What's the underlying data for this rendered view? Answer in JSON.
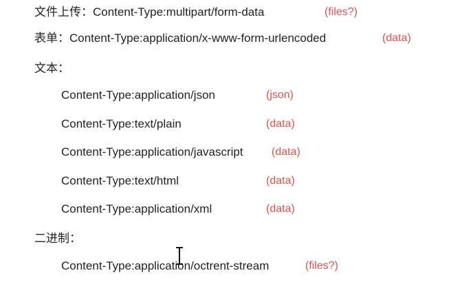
{
  "sections": [
    {
      "label": "文件上传：",
      "content_type": "Content-Type:multipart/form-data",
      "param": "(files?)"
    },
    {
      "label": "表单：",
      "content_type": "Content-Type:application/x-www-form-urlencoded",
      "param": "(data)"
    },
    {
      "label": "文本：",
      "items": [
        {
          "content_type": "Content-Type:application/json",
          "param": "(json)"
        },
        {
          "content_type": "Content-Type:text/plain",
          "param": "(data)"
        },
        {
          "content_type": "Content-Type:application/javascript",
          "param": "(data)"
        },
        {
          "content_type": "Content-Type:text/html",
          "param": "(data)"
        },
        {
          "content_type": "Content-Type:application/xml",
          "param": "(data)"
        }
      ]
    },
    {
      "label": "二进制：",
      "items": [
        {
          "content_type": "Content-Type:application/octrent-stream",
          "param": "(files?)"
        }
      ]
    }
  ],
  "colors": {
    "text": "#222222",
    "param": "#d9534f",
    "background": "#ffffff"
  },
  "cursor_icon": "text-cursor-icon"
}
